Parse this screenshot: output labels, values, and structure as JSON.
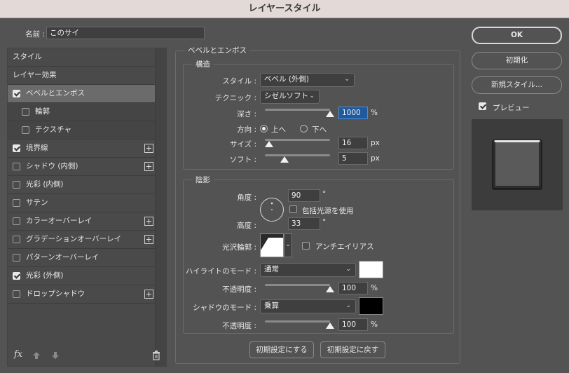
{
  "window": {
    "title": "レイヤースタイル"
  },
  "name_field": {
    "label": "名前 :",
    "value": "このサイ"
  },
  "styles_list": {
    "items": [
      {
        "label": "スタイル",
        "checkbox": false,
        "checked": false,
        "add": false,
        "selected": false,
        "sub": false
      },
      {
        "label": "レイヤー効果",
        "checkbox": false,
        "checked": false,
        "add": false,
        "selected": false,
        "sub": false
      },
      {
        "label": "ベベルとエンボス",
        "checkbox": true,
        "checked": true,
        "add": false,
        "selected": true,
        "sub": false
      },
      {
        "label": "輪郭",
        "checkbox": true,
        "checked": false,
        "add": false,
        "selected": false,
        "sub": true
      },
      {
        "label": "テクスチャ",
        "checkbox": true,
        "checked": false,
        "add": false,
        "selected": false,
        "sub": true
      },
      {
        "label": "境界線",
        "checkbox": true,
        "checked": true,
        "add": true,
        "selected": false,
        "sub": false
      },
      {
        "label": "シャドウ (内側)",
        "checkbox": true,
        "checked": false,
        "add": true,
        "selected": false,
        "sub": false
      },
      {
        "label": "光彩 (内側)",
        "checkbox": true,
        "checked": false,
        "add": false,
        "selected": false,
        "sub": false
      },
      {
        "label": "サテン",
        "checkbox": true,
        "checked": false,
        "add": false,
        "selected": false,
        "sub": false
      },
      {
        "label": "カラーオーバーレイ",
        "checkbox": true,
        "checked": false,
        "add": true,
        "selected": false,
        "sub": false
      },
      {
        "label": "グラデーションオーバーレイ",
        "checkbox": true,
        "checked": false,
        "add": true,
        "selected": false,
        "sub": false
      },
      {
        "label": "パターンオーバーレイ",
        "checkbox": true,
        "checked": false,
        "add": false,
        "selected": false,
        "sub": false
      },
      {
        "label": "光彩 (外側)",
        "checkbox": true,
        "checked": true,
        "add": false,
        "selected": false,
        "sub": false
      },
      {
        "label": "ドロップシャドウ",
        "checkbox": true,
        "checked": false,
        "add": true,
        "selected": false,
        "sub": false
      }
    ],
    "footer": {
      "fx_label": "fx",
      "fx_icon": "fx-icon",
      "up_icon": "arrow-up-icon",
      "down_icon": "arrow-down-icon",
      "trash_icon": "trash-icon"
    }
  },
  "bevel": {
    "section_title": "ベベルとエンボス",
    "structure": {
      "title": "構造",
      "style_label": "スタイル :",
      "style_value": "ベベル (外側)",
      "technique_label": "テクニック :",
      "technique_value": "シゼルソフト",
      "depth_label": "深さ :",
      "depth_value": "1000",
      "depth_unit": "%",
      "depth_fraction": 1.0,
      "direction_label": "方向 :",
      "direction_up": "上へ",
      "direction_down": "下へ",
      "direction_selected": "up",
      "size_label": "サイズ :",
      "size_value": "16",
      "size_unit": "px",
      "size_fraction": 0.06,
      "soften_label": "ソフト :",
      "soften_value": "5",
      "soften_unit": "px",
      "soften_fraction": 0.3
    },
    "shading": {
      "title": "陰影",
      "angle_label": "角度 :",
      "angle_value": "90",
      "angle_unit": "°",
      "global_light_label": "包括光源を使用",
      "global_light_checked": false,
      "altitude_label": "高度 :",
      "altitude_value": "33",
      "altitude_unit": "°",
      "gloss_label": "光沢輪郭 :",
      "antialias_label": "アンチエイリアス",
      "antialias_checked": false,
      "highlight_mode_label": "ハイライトのモード :",
      "highlight_mode_value": "通常",
      "highlight_color": "#ffffff",
      "highlight_opacity_label": "不透明度 :",
      "highlight_opacity_value": "100",
      "highlight_opacity_unit": "%",
      "highlight_opacity_fraction": 1.0,
      "shadow_mode_label": "シャドウのモード :",
      "shadow_mode_value": "乗算",
      "shadow_color": "#000000",
      "shadow_opacity_label": "不透明度 :",
      "shadow_opacity_value": "100",
      "shadow_opacity_unit": "%",
      "shadow_opacity_fraction": 1.0
    },
    "make_default": "初期設定にする",
    "reset_default": "初期設定に戻す"
  },
  "buttons": {
    "ok": "OK",
    "reset": "初期化",
    "new_style": "新規スタイル...",
    "preview_label": "プレビュー",
    "preview_checked": true
  },
  "colors": {
    "panel": "#535353",
    "title_bar": "#e3d9d6",
    "selected_row": "#6b6b6b",
    "highlight_input": "#1f5aa0"
  }
}
